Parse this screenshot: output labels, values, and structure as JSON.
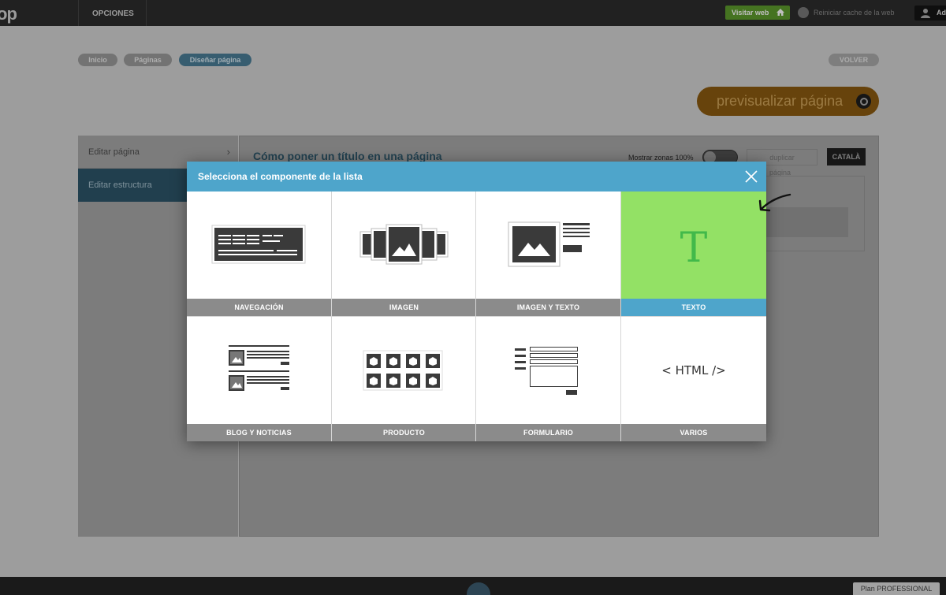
{
  "topbar": {
    "logo": "op",
    "opciones": "OPCIONES",
    "visitar_web": "Visitar web",
    "reiniciar_cache": "Reiniciar cache de la web",
    "user_name": "Ad"
  },
  "breadcrumb": [
    "Inicio",
    "Páginas",
    "Diseñar página"
  ],
  "volver": "VOLVER",
  "preview_button": "previsualizar página",
  "left_panel": {
    "items": [
      "Editar página",
      "Editar estructura"
    ],
    "chevron": "›"
  },
  "main": {
    "title": "Cómo poner un título en una página",
    "mostrar_zonas": "Mostrar zonas 100%",
    "duplicar": "duplicar",
    "catala": "CATALÀ",
    "pagina_label": "página"
  },
  "modal": {
    "title": "Selecciona el componente de la lista",
    "components": [
      {
        "label": "NAVEGACIÓN",
        "icon": "navigation-icon"
      },
      {
        "label": "IMAGEN",
        "icon": "image-carousel-icon"
      },
      {
        "label": "IMAGEN Y TEXTO",
        "icon": "image-text-icon"
      },
      {
        "label": "TEXTO",
        "icon": "text-icon",
        "glyph": "T",
        "selected": true
      },
      {
        "label": "BLOG Y NOTICIAS",
        "icon": "blog-icon"
      },
      {
        "label": "PRODUCTO",
        "icon": "product-grid-icon"
      },
      {
        "label": "FORMULARIO",
        "icon": "form-icon"
      },
      {
        "label": "VARIOS",
        "icon": "html-code-icon",
        "glyph": "< HTML />"
      }
    ]
  },
  "footer": {
    "plan": "Plan PROFESSIONAL"
  },
  "colors": {
    "accent_blue": "#4ea5cb",
    "selected_green": "#93e165",
    "text_green": "#42b94a",
    "label_gray": "#8b8b8b"
  }
}
